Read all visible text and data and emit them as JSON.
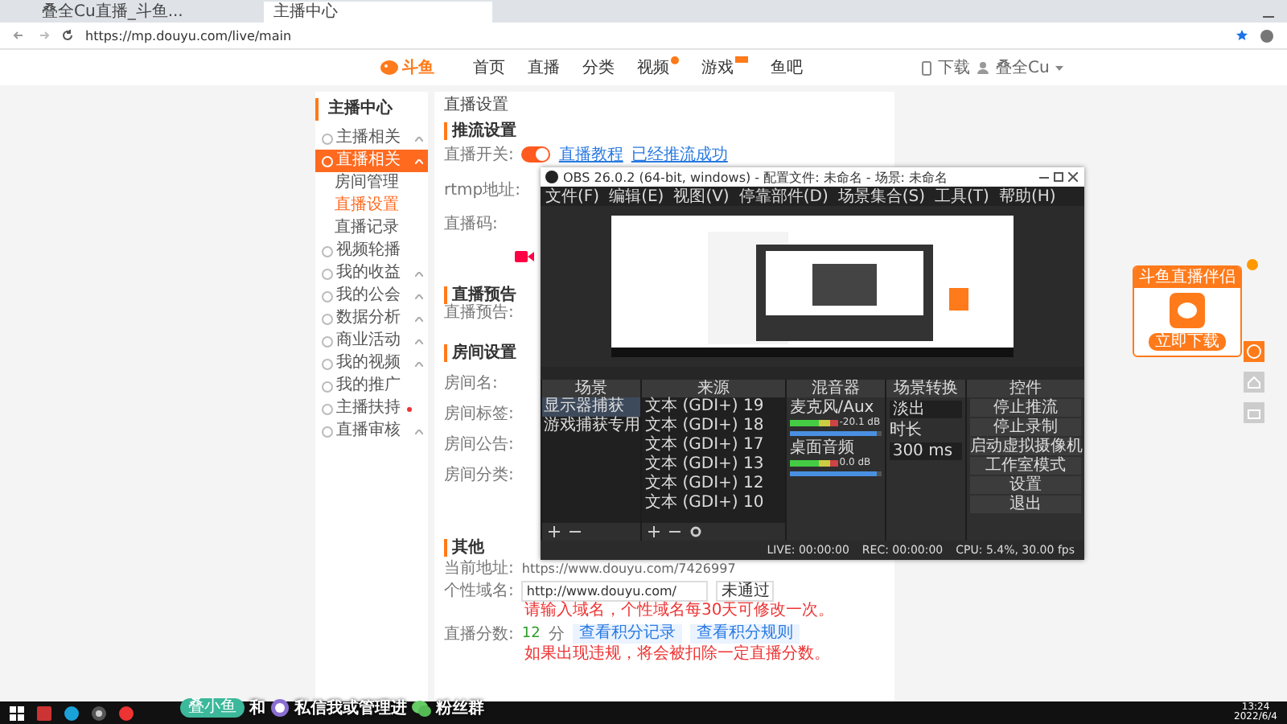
{
  "browser": {
    "tabs": [
      {
        "title": "叠全Cu直播_斗鱼...",
        "selected": false
      },
      {
        "title": "主播中心",
        "selected": true
      }
    ],
    "address": "https://mp.douyu.com/live/main"
  },
  "site_nav": {
    "logo": "斗鱼",
    "items": [
      {
        "label": "首页",
        "dot": false,
        "tag": false
      },
      {
        "label": "直播",
        "dot": false,
        "tag": false
      },
      {
        "label": "分类",
        "dot": false,
        "tag": false
      },
      {
        "label": "视频",
        "dot": true,
        "tag": false
      },
      {
        "label": "游戏",
        "dot": false,
        "tag": true
      },
      {
        "label": "鱼吧",
        "dot": false,
        "tag": false
      }
    ],
    "download": "下载",
    "user": "叠全Cu"
  },
  "sidebar": {
    "title": "主播中心",
    "items": [
      {
        "label": "主播相关",
        "selected": false,
        "caret": true,
        "dot": false
      },
      {
        "label": "直播相关",
        "selected": true,
        "caret": true,
        "dot": false,
        "children": [
          {
            "label": "房间管理",
            "selected": false
          },
          {
            "label": "直播设置",
            "selected": true
          },
          {
            "label": "直播记录",
            "selected": false
          }
        ]
      },
      {
        "label": "视频轮播",
        "selected": false,
        "caret": false,
        "dot": false
      },
      {
        "label": "我的收益",
        "selected": false,
        "caret": true,
        "dot": false
      },
      {
        "label": "我的公会",
        "selected": false,
        "caret": true,
        "dot": false
      },
      {
        "label": "数据分析",
        "selected": false,
        "caret": true,
        "dot": false
      },
      {
        "label": "商业活动",
        "selected": false,
        "caret": true,
        "dot": false
      },
      {
        "label": "我的视频",
        "selected": false,
        "caret": true,
        "dot": false
      },
      {
        "label": "我的推广",
        "selected": false,
        "caret": false,
        "dot": false
      },
      {
        "label": "主播扶持",
        "selected": false,
        "caret": false,
        "dot": true
      },
      {
        "label": "直播审核",
        "selected": false,
        "caret": true,
        "dot": false
      }
    ]
  },
  "main": {
    "title": "直播设置",
    "push": {
      "heading": "推流设置",
      "switch_label": "直播开关:",
      "on": true,
      "links": [
        "直播教程",
        "已经推流成功"
      ],
      "rtmp_label": "rtmp地址:",
      "code_label": "直播码:"
    },
    "notice": {
      "heading": "直播预告",
      "label": "直播预告:"
    },
    "room": {
      "heading": "房间设置",
      "labels": [
        "房间名:",
        "房间标签:",
        "房间公告:",
        "房间分类:"
      ]
    },
    "other": {
      "heading": "其他",
      "current_label": "当前地址:",
      "current_url": "https://www.douyu.com/7426997",
      "domain_label": "个性域名:",
      "domain_value": "http://www.douyu.com/",
      "domain_status": "未通过",
      "domain_hint": "请输入域名，个性域名每30天可修改一次。",
      "score_label": "直播分数:",
      "score": "12",
      "score_unit": "分",
      "score_links": [
        "查看积分记录",
        "查看积分规则"
      ],
      "score_note": "如果出现违规，将会被扣除一定直播分数。"
    }
  },
  "obs": {
    "title": "OBS 26.0.2 (64-bit, windows) - 配置文件: 未命名 - 场景: 未命名",
    "menu": [
      "文件(F)",
      "编辑(E)",
      "视图(V)",
      "停靠部件(D)",
      "场景集合(S)",
      "工具(T)",
      "帮助(H)"
    ],
    "scenes": {
      "title": "场景",
      "items": [
        {
          "name": "显示器捕获",
          "selected": true
        },
        {
          "name": "游戏捕获专用",
          "selected": false
        }
      ]
    },
    "sources": {
      "title": "来源",
      "items": [
        "文本 (GDI+) 19",
        "文本 (GDI+) 18",
        "文本 (GDI+) 17",
        "文本 (GDI+) 13",
        "文本 (GDI+) 12",
        "文本 (GDI+) 10"
      ]
    },
    "mixer": {
      "title": "混音器",
      "channels": [
        {
          "name": "麦克风/Aux",
          "reading": "-20.1 dB",
          "level": 0.95
        },
        {
          "name": "桌面音频",
          "reading": "0.0 dB",
          "level": 0.95
        }
      ]
    },
    "transitions": {
      "title": "场景转换",
      "value": "淡出",
      "duration_label": "时长",
      "duration": "300 ms"
    },
    "controls": {
      "title": "控件",
      "buttons": [
        "停止推流",
        "停止录制",
        "启动虚拟摄像机",
        "工作室模式",
        "设置",
        "退出"
      ]
    },
    "status": [
      "LIVE: 00:00:00",
      "REC: 00:00:00",
      "CPU: 5.4%, 30.00 fps"
    ]
  },
  "widget": {
    "title": "斗鱼直播伴侣",
    "button": "立即下载"
  },
  "banner": {
    "badge": "叠小鱼",
    "joiner": "和",
    "text": "私信我或管理进",
    "group": "粉丝群"
  },
  "taskbar": {
    "time": "13:24",
    "date": "2022/6/4"
  }
}
